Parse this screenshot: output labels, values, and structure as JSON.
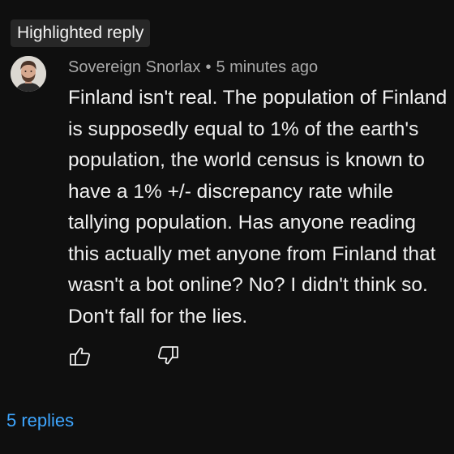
{
  "badge": {
    "label": "Highlighted reply"
  },
  "comment": {
    "author": "Sovereign Snorlax",
    "separator": "•",
    "timestamp": "5 minutes ago",
    "body": "Finland isn't real. The population of Finland is supposedly equal to 1% of the earth's population, the world census is known to have a 1% +/- discrepancy rate while tallying population. Has anyone reading this actually met anyone from Finland that wasn't a bot online? No? I didn't think so. Don't fall for the lies."
  },
  "actions": {
    "like_icon": "thumbs-up-icon",
    "dislike_icon": "thumbs-down-icon"
  },
  "replies": {
    "label": "5 replies"
  },
  "colors": {
    "background": "#0f0f0f",
    "text": "#f1f1f1",
    "secondary_text": "#aaaaaa",
    "badge_bg": "#272727",
    "link": "#3ea6ff"
  }
}
